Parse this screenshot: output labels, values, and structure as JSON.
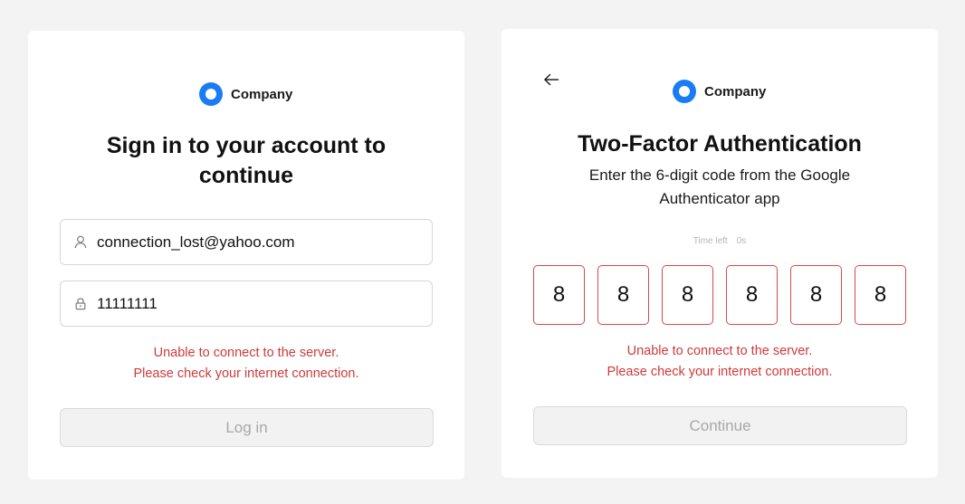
{
  "login": {
    "brand_name": "Company",
    "title_line1": "Sign in to your account to",
    "title_line2": "continue",
    "email_value": "connection_lost@yahoo.com",
    "password_value": "11111111",
    "error_line1": "Unable to connect to the server.",
    "error_line2": "Please check your internet connection.",
    "login_button_label": "Log in"
  },
  "two_factor": {
    "brand_name": "Company",
    "title": "Two-Factor Authentication",
    "subtitle_line1": "Enter the 6-digit code from the Google",
    "subtitle_line2": "Authenticator app",
    "timer_label": "Time left",
    "timer_value": "0s",
    "code_digits": [
      "8",
      "8",
      "8",
      "8",
      "8",
      "8"
    ],
    "error_line1": "Unable to connect to the server.",
    "error_line2": "Please check your internet connection.",
    "continue_button_label": "Continue"
  },
  "colors": {
    "page_background": "#f3f3f3",
    "brand_blue": "#1a7cf5",
    "error_red": "#cf3a3a",
    "disabled_text": "#a8a8a8"
  },
  "icons": {
    "email_field": "user-icon",
    "password_field": "lock-icon",
    "back": "arrow-left-icon",
    "brand": "company-logo-icon"
  }
}
